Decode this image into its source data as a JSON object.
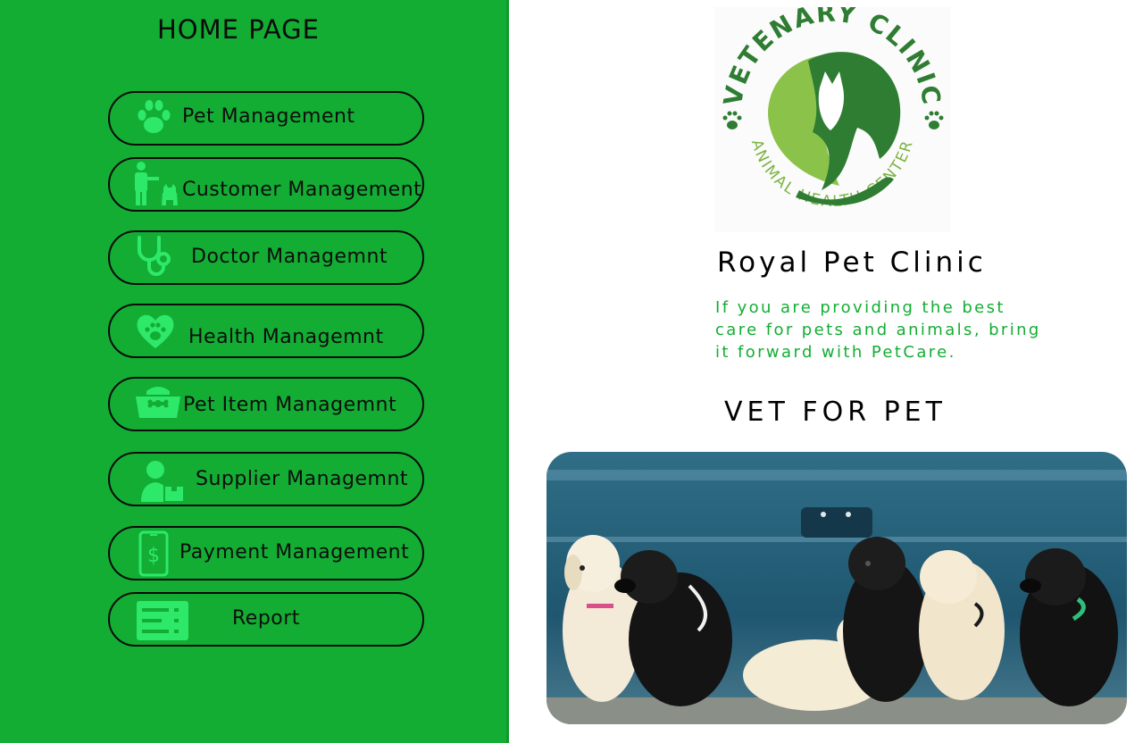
{
  "sidebar": {
    "title": "HOME PAGE",
    "items": [
      {
        "label": "Pet Management",
        "icon": "paw-icon"
      },
      {
        "label": "Customer Management",
        "icon": "person-with-dog-icon"
      },
      {
        "label": "Doctor Managemnt",
        "icon": "stethoscope-icon"
      },
      {
        "label": "Health Managemnt",
        "icon": "heart-paw-icon"
      },
      {
        "label": "Pet Item Managemnt",
        "icon": "pet-bowl-icon"
      },
      {
        "label": "Supplier Managemnt",
        "icon": "supplier-icon"
      },
      {
        "label": "Payment Management",
        "icon": "mobile-payment-icon"
      },
      {
        "label": "Report",
        "icon": "report-list-icon"
      }
    ]
  },
  "logo": {
    "top_text": "VETENARY CLINIC",
    "bottom_text": "ANIMAL HEALTH CENTER"
  },
  "main": {
    "clinic_name": "Royal Pet Clinic",
    "tagline": "If you are providing the best care for pets and animals, bring it forward with PetCare.",
    "vet_title": "VET FOR PET"
  },
  "colors": {
    "sidebar_bg": "#13ad34",
    "icon_green": "#2ee86a",
    "tagline_green": "#13ad34",
    "logo_dark_green": "#2e7d32",
    "logo_light_green": "#8bc34a"
  }
}
